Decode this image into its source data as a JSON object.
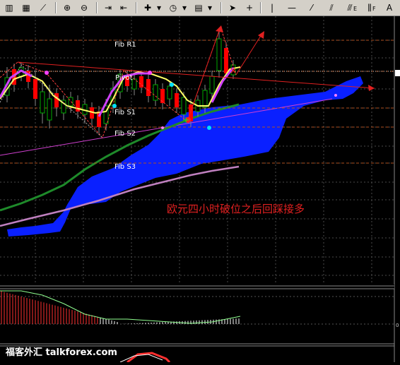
{
  "toolbar": {
    "buttons": [
      {
        "name": "bar-chart-icon",
        "glyph": "▥"
      },
      {
        "name": "candlestick-icon",
        "glyph": "▦"
      },
      {
        "name": "line-chart-icon",
        "glyph": "⟋"
      },
      {
        "name": "zoom-in-icon",
        "glyph": "⊕"
      },
      {
        "name": "zoom-out-icon",
        "glyph": "⊖"
      },
      {
        "name": "chart-shift-icon",
        "glyph": "⇥"
      },
      {
        "name": "autoscroll-icon",
        "glyph": "⇤"
      },
      {
        "name": "indicators-icon",
        "glyph": "✚"
      },
      {
        "name": "periods-icon",
        "glyph": "◷"
      },
      {
        "name": "templates-icon",
        "glyph": "▤"
      },
      {
        "name": "cursor-icon",
        "glyph": "➤"
      },
      {
        "name": "crosshair-icon",
        "glyph": "+"
      },
      {
        "name": "vertical-line-icon",
        "glyph": "|"
      },
      {
        "name": "horizontal-line-icon",
        "glyph": "—"
      },
      {
        "name": "trendline-icon",
        "glyph": "⁄"
      },
      {
        "name": "equidistant-channel-icon",
        "glyph": "⫽"
      },
      {
        "name": "fibonacci-icon",
        "glyph": "⫻"
      },
      {
        "name": "text-label-icon",
        "glyph": "A"
      }
    ],
    "tool_letters": {
      "e": "E",
      "f": "F"
    }
  },
  "labels": {
    "fib_r1": "Fib R1",
    "pivot": "Pivot",
    "fib_s1": "Fib S1",
    "fib_s2": "Fib S2",
    "fib_s3": "Fib S3",
    "annotation": "欧元四小时破位之后回踩接多",
    "watermark": "福客外汇 talkforex.com",
    "macd_zero": "0"
  },
  "colors": {
    "background": "#000000",
    "grid": "#555555",
    "bull": "#00ff00",
    "bear": "#ff0000",
    "cloud": "#0a20ff",
    "ma_green": "#1a8a2a",
    "ma_pink": "#c070c0",
    "trendline": "#e040e0",
    "annotation": "#e02020",
    "fib_line": "#b05020"
  }
}
